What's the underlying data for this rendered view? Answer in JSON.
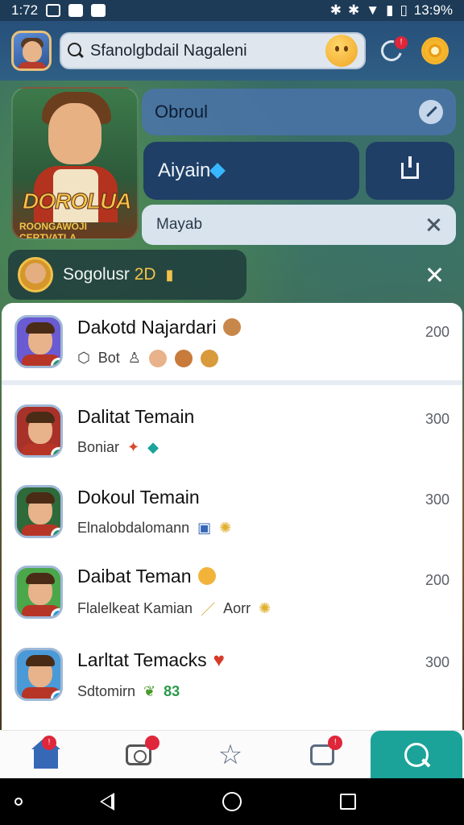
{
  "status_bar": {
    "time": "1:72",
    "battery": "13:9%"
  },
  "header": {
    "search_text": "Sfanolgbdail Nagaleni",
    "notifications_badge": "!"
  },
  "hero": {
    "logo_title": "DOROLUA",
    "logo_subtitle": "ROONGAWOJI CERTVATLA"
  },
  "profile": {
    "name": "Obroul",
    "username": "Aiyain",
    "input_value": "Mayab"
  },
  "group": {
    "label": "Sogolusr",
    "count": "2D"
  },
  "list": [
    {
      "name": "Dakotd Najardari",
      "sub": "Bot",
      "score": "200",
      "status_color": "#1d9a6b"
    },
    {
      "name": "Dalitat Temain",
      "sub": "Boniar",
      "score": "300",
      "status_color": "#1d9a6b"
    },
    {
      "name": "Dokoul Temain",
      "sub": "Elnalobdalomann",
      "score": "300",
      "status_color": "#1d9a6b"
    },
    {
      "name": "Daibat Teman",
      "sub": "Flalelkeat Kamian",
      "score": "200",
      "status_color": "#1e9de0"
    },
    {
      "name": "Larltat Temacks",
      "sub": "Sdtomirn",
      "score": "300",
      "status_color": "#1e9de0"
    }
  ],
  "list_extras": {
    "item3_tail": "Aorr",
    "item4_tail": "83"
  },
  "nav": {
    "home_badge": "!",
    "camera_badge": "",
    "chat_badge": "!",
    "active_color": "#1ba39a"
  }
}
